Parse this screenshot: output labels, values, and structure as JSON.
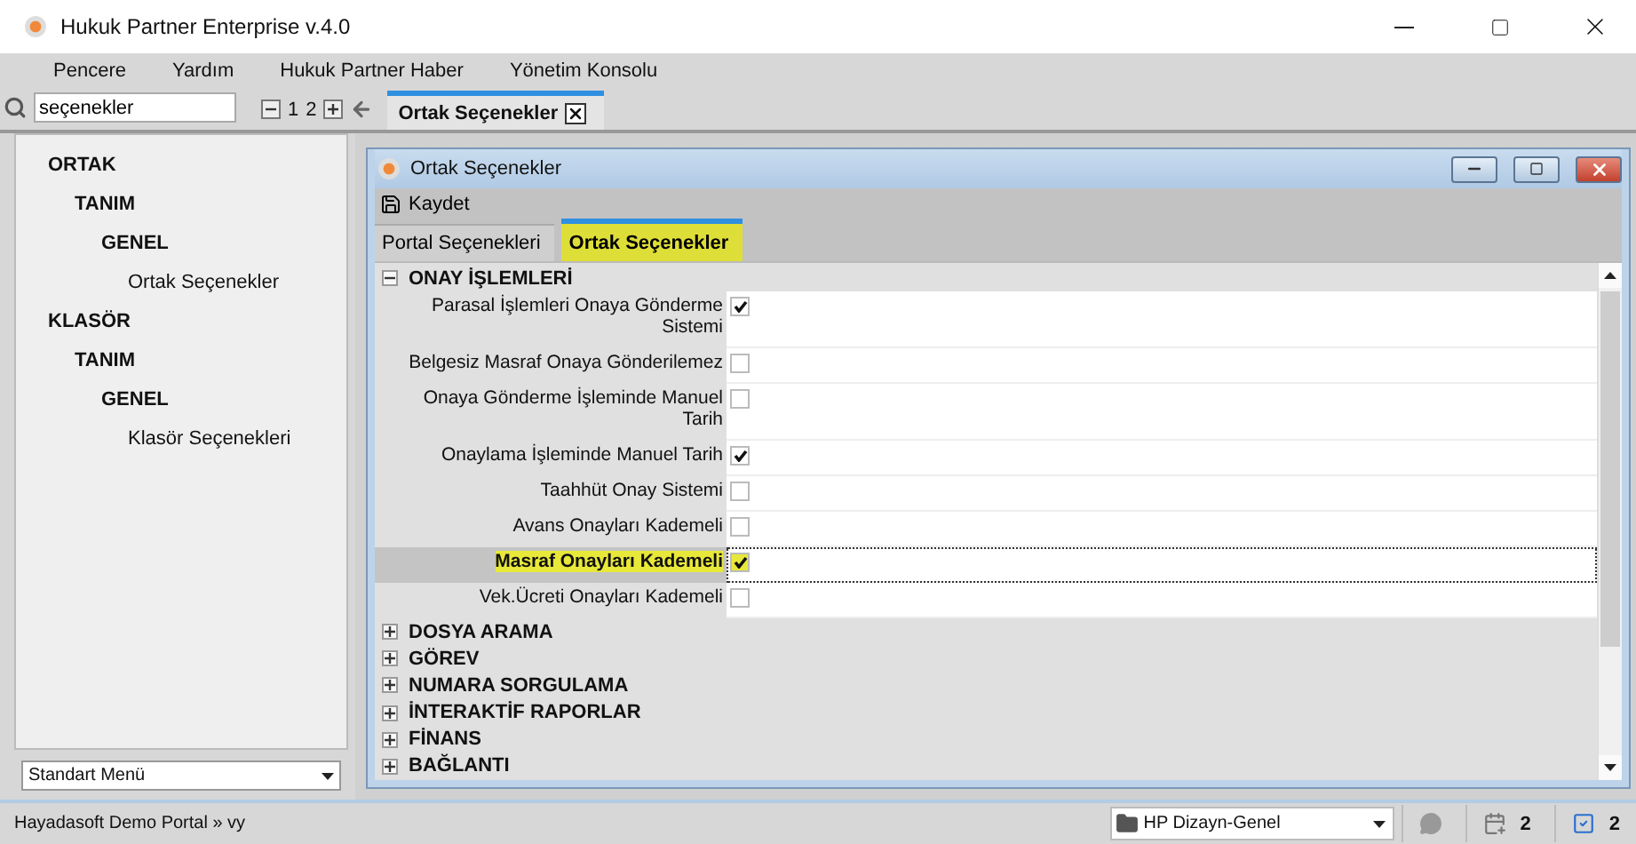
{
  "window": {
    "title": "Hukuk Partner Enterprise v.4.0"
  },
  "menu": [
    "Pencere",
    "Yardım",
    "Hukuk Partner Haber",
    "Yönetim Konsolu"
  ],
  "search": {
    "value": "seçenekler"
  },
  "pager": {
    "pages": [
      "1",
      "2"
    ]
  },
  "doc_tabs": [
    {
      "label": "Ortak Seçenekler",
      "selected": true
    }
  ],
  "sidebar": {
    "tree": [
      {
        "label": "ORTAK",
        "children": [
          {
            "label": "TANIM",
            "children": [
              {
                "label": "GENEL",
                "children": [
                  {
                    "label": "Ortak Seçenekler"
                  }
                ]
              }
            ]
          }
        ]
      },
      {
        "label": "KLASÖR",
        "children": [
          {
            "label": "TANIM",
            "children": [
              {
                "label": "GENEL",
                "children": [
                  {
                    "label": "Klasör Seçenekleri"
                  }
                ]
              }
            ]
          }
        ]
      }
    ],
    "menu_select": {
      "value": "Standart Menü"
    }
  },
  "inner_window": {
    "title": "Ortak Seçenekler",
    "toolbar": [
      {
        "label": "Kaydet"
      }
    ],
    "tabs": [
      {
        "label": "Portal Seçenekleri",
        "selected": false
      },
      {
        "label": "Ortak Seçenekler",
        "selected": true
      }
    ],
    "sections": [
      {
        "title": "ONAY İŞLEMLERİ",
        "expanded": true,
        "options": [
          {
            "label": "Parasal İşlemleri Onaya Gönderme Sistemi",
            "checked": true,
            "selected": false
          },
          {
            "label": "Belgesiz Masraf Onaya Gönderilemez",
            "checked": false,
            "selected": false
          },
          {
            "label": "Onaya Gönderme İşleminde Manuel Tarih",
            "checked": false,
            "selected": false
          },
          {
            "label": "Onaylama İşleminde Manuel Tarih",
            "checked": true,
            "selected": false
          },
          {
            "label": "Taahhüt Onay Sistemi",
            "checked": false,
            "selected": false
          },
          {
            "label": "Avans Onayları Kademeli",
            "checked": false,
            "selected": false
          },
          {
            "label": "Masraf Onayları Kademeli",
            "checked": true,
            "selected": true
          },
          {
            "label": "Vek.Ücreti Onayları Kademeli",
            "checked": false,
            "selected": false
          }
        ]
      },
      {
        "title": "DOSYA ARAMA",
        "expanded": false
      },
      {
        "title": "GÖREV",
        "expanded": false
      },
      {
        "title": "NUMARA SORGULAMA",
        "expanded": false
      },
      {
        "title": "İNTERAKTİF RAPORLAR",
        "expanded": false
      },
      {
        "title": "FİNANS",
        "expanded": false
      },
      {
        "title": "BAĞLANTI",
        "expanded": false
      }
    ]
  },
  "status_bar": {
    "portal": "Hayadasoft Demo Portal » vy",
    "design": "HP Dizayn-Genel",
    "calendar_count": "2",
    "task_count": "2"
  }
}
